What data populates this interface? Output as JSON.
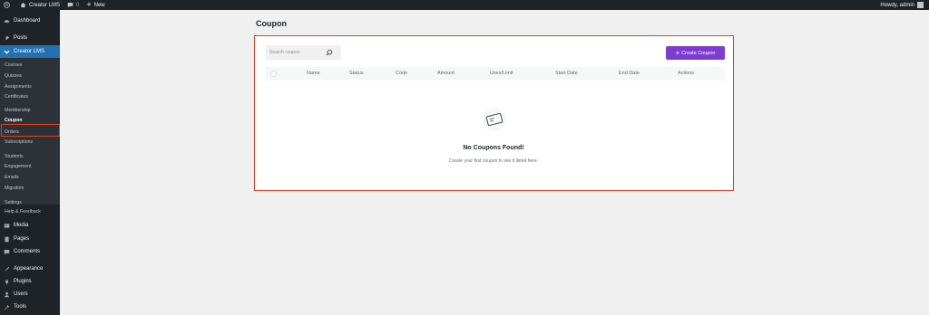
{
  "adminbar": {
    "site_name": "Creator LMS",
    "comments_count": "0",
    "new_label": "New",
    "howdy": "Howdy, admin"
  },
  "sidebar": {
    "dashboard": "Dashboard",
    "posts": "Posts",
    "creator_lms": "Creator LMS",
    "submenu": [
      "Courses",
      "Quizzes",
      "Assignments",
      "Certificates",
      "Membership",
      "Coupon",
      "Orders",
      "Subscriptions",
      "Students",
      "Engagement",
      "Emails",
      "Migration",
      "Settings",
      "Help & Feedback"
    ],
    "media": "Media",
    "pages": "Pages",
    "comments": "Comments",
    "appearance": "Appearance",
    "plugins": "Plugins",
    "users": "Users",
    "tools": "Tools"
  },
  "page": {
    "title": "Coupon",
    "search_placeholder": "Search coupon",
    "create_label": "Create Coupon",
    "columns": [
      "Name",
      "Status",
      "Code",
      "Amount",
      "Uses/Limit",
      "Start Date",
      "End Date",
      "Actions"
    ],
    "empty_title": "No Coupons Found!",
    "empty_subtitle": "Create your first coupon to see it listed here."
  },
  "colors": {
    "accent": "#7e3bd0",
    "highlight": "#e2401c",
    "wp_blue": "#2271b1"
  }
}
